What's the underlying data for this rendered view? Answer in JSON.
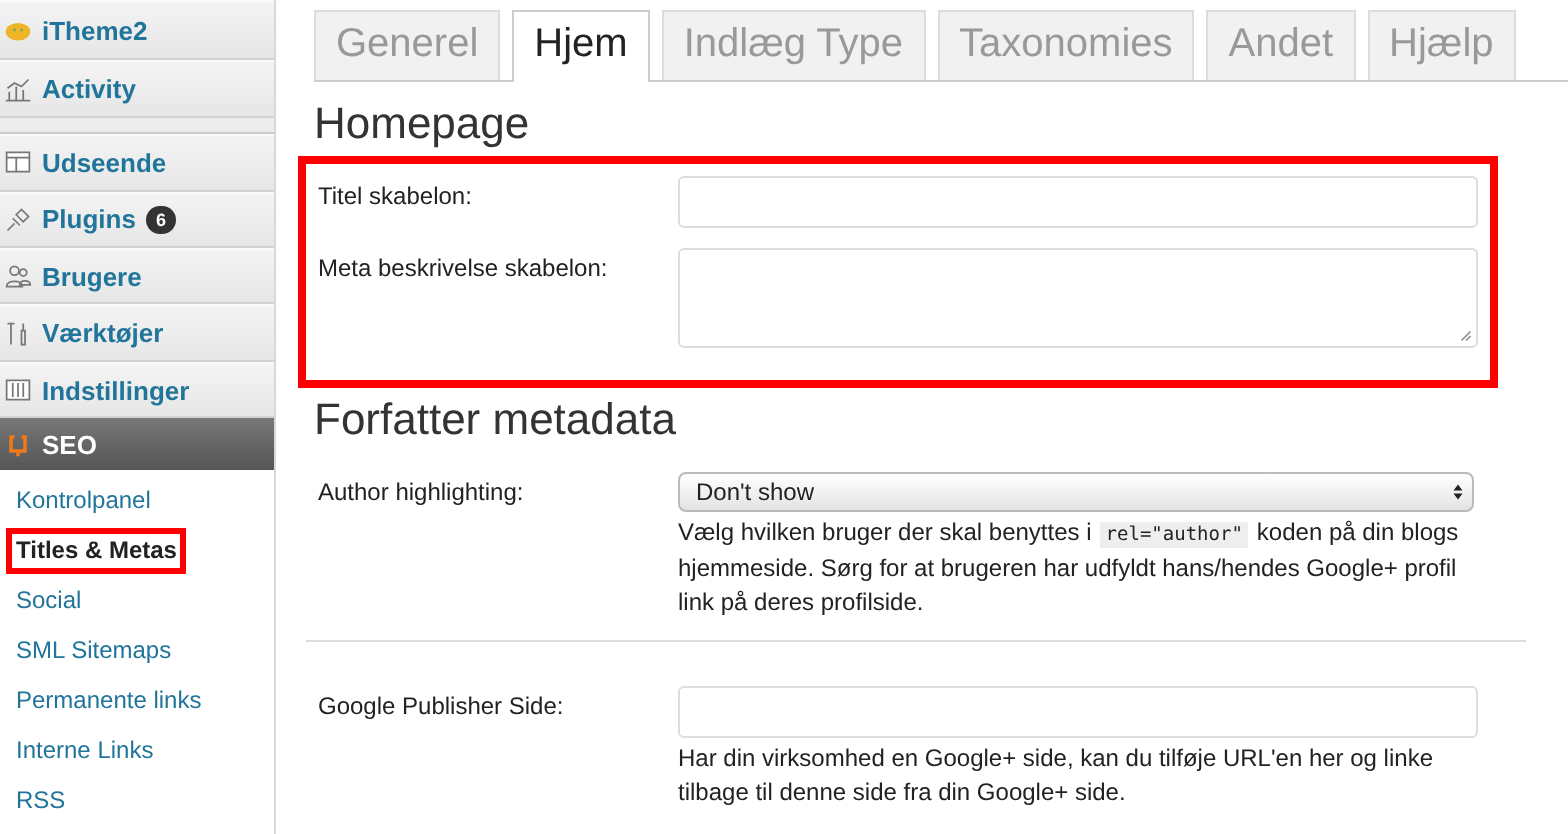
{
  "sidebar": {
    "items": [
      {
        "label": "iTheme2",
        "group_start": false
      },
      {
        "label": "Activity",
        "group_start": false
      },
      {
        "label": "Udseende",
        "group_start": true
      },
      {
        "label": "Plugins",
        "badge": "6",
        "group_start": false
      },
      {
        "label": "Brugere",
        "group_start": false
      },
      {
        "label": "Værktøjer",
        "group_start": false
      },
      {
        "label": "Indstillinger",
        "group_start": false
      }
    ],
    "current": {
      "label": "SEO"
    },
    "submenu": [
      {
        "label": "Kontrolpanel",
        "selected": false,
        "highlighted": false
      },
      {
        "label": "Titles & Metas",
        "selected": true,
        "highlighted": true
      },
      {
        "label": "Social",
        "selected": false,
        "highlighted": false
      },
      {
        "label": "SML Sitemaps",
        "selected": false,
        "highlighted": false
      },
      {
        "label": "Permanente links",
        "selected": false,
        "highlighted": false
      },
      {
        "label": "Interne Links",
        "selected": false,
        "highlighted": false
      },
      {
        "label": "RSS",
        "selected": false,
        "highlighted": false
      }
    ]
  },
  "tabs": [
    {
      "label": "Generel",
      "selected": false
    },
    {
      "label": "Hjem",
      "selected": true
    },
    {
      "label": "Indlæg Type",
      "selected": false
    },
    {
      "label": "Taxonomies",
      "selected": false
    },
    {
      "label": "Andet",
      "selected": false
    },
    {
      "label": "Hjælp",
      "selected": false
    }
  ],
  "sections": [
    {
      "title": "Homepage",
      "highlighted": true,
      "fields": [
        {
          "kind": "input",
          "label": "Titel skabelon:"
        },
        {
          "kind": "textarea",
          "label": "Meta beskrivelse skabelon:"
        }
      ]
    },
    {
      "title": "Forfatter metadata",
      "highlighted": false,
      "fields": [
        {
          "kind": "select",
          "label": "Author highlighting:",
          "value": "Don't show",
          "help": {
            "before": "Vælg hvilken bruger der skal benyttes i",
            "code": "rel=\"author\"",
            "after": "koden på din blogs hjemmeside. Sørg for at brugeren har udfyldt hans/hendes Google+ profil link på deres profilside."
          }
        },
        {
          "kind": "divider"
        },
        {
          "kind": "input",
          "label": "Google Publisher Side:",
          "help": {
            "before": "Har din virksomhed en Google+ side, kan du tilføje URL'en her og linke tilbage til denne side fra din Google+ side."
          }
        }
      ]
    }
  ]
}
